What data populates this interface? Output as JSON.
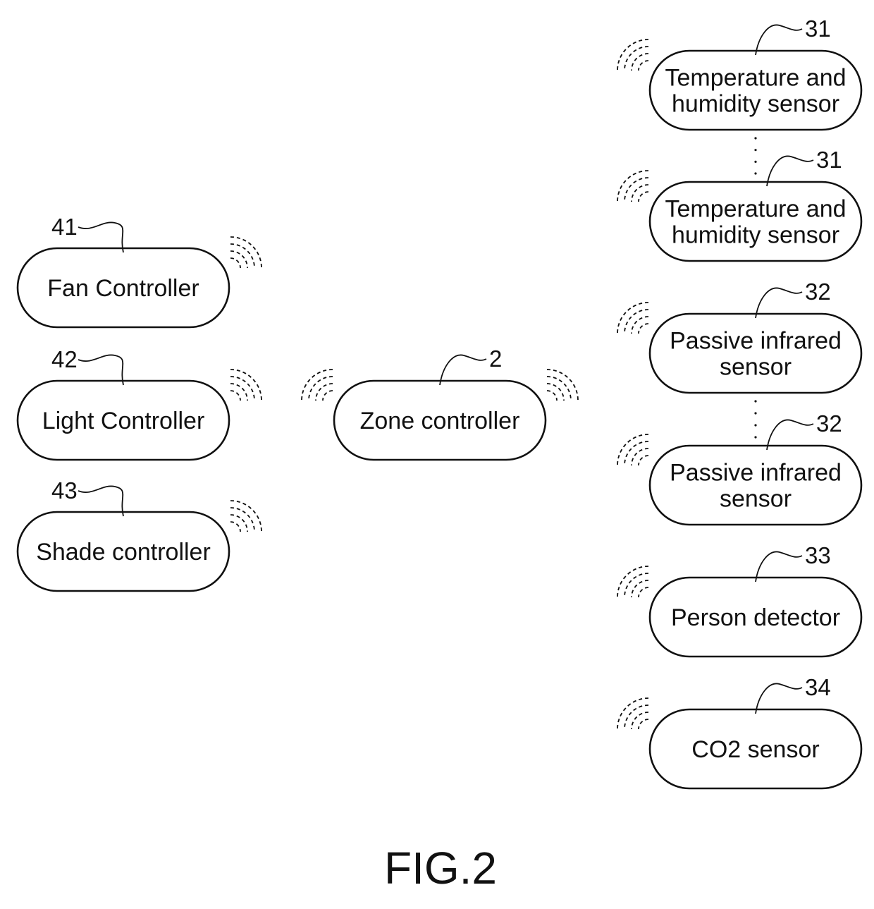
{
  "figure": {
    "caption": "FIG.2"
  },
  "nodes": [
    {
      "id": "fan-controller",
      "ref": "41",
      "lines": [
        "Fan Controller"
      ],
      "group": "controllers",
      "signal": "right"
    },
    {
      "id": "light-controller",
      "ref": "42",
      "lines": [
        "Light Controller"
      ],
      "group": "controllers",
      "signal": "right"
    },
    {
      "id": "shade-controller",
      "ref": "43",
      "lines": [
        "Shade controller"
      ],
      "group": "controllers",
      "signal": "right"
    },
    {
      "id": "zone-controller",
      "ref": "2",
      "lines": [
        "Zone controller"
      ],
      "group": "hub",
      "signal": "both"
    },
    {
      "id": "temperature-humidity-sensor-1",
      "ref": "31",
      "lines": [
        "Temperature and",
        "humidity sensor"
      ],
      "group": "sensors",
      "signal": "left"
    },
    {
      "id": "temperature-humidity-sensor-2",
      "ref": "31",
      "lines": [
        "Temperature and",
        "humidity sensor"
      ],
      "group": "sensors",
      "signal": "left"
    },
    {
      "id": "passive-infrared-sensor-1",
      "ref": "32",
      "lines": [
        "Passive infrared",
        "sensor"
      ],
      "group": "sensors",
      "signal": "left"
    },
    {
      "id": "passive-infrared-sensor-2",
      "ref": "32",
      "lines": [
        "Passive infrared",
        "sensor"
      ],
      "group": "sensors",
      "signal": "left"
    },
    {
      "id": "person-detector",
      "ref": "33",
      "lines": [
        "Person detector"
      ],
      "group": "sensors",
      "signal": "left"
    },
    {
      "id": "co2-sensor",
      "ref": "34",
      "lines": [
        "CO2 sensor"
      ],
      "group": "sensors",
      "signal": "left"
    }
  ],
  "ellipses": [
    {
      "between": [
        "temperature-humidity-sensor-1",
        "temperature-humidity-sensor-2"
      ]
    },
    {
      "between": [
        "passive-infrared-sensor-1",
        "passive-infrared-sensor-2"
      ]
    }
  ]
}
